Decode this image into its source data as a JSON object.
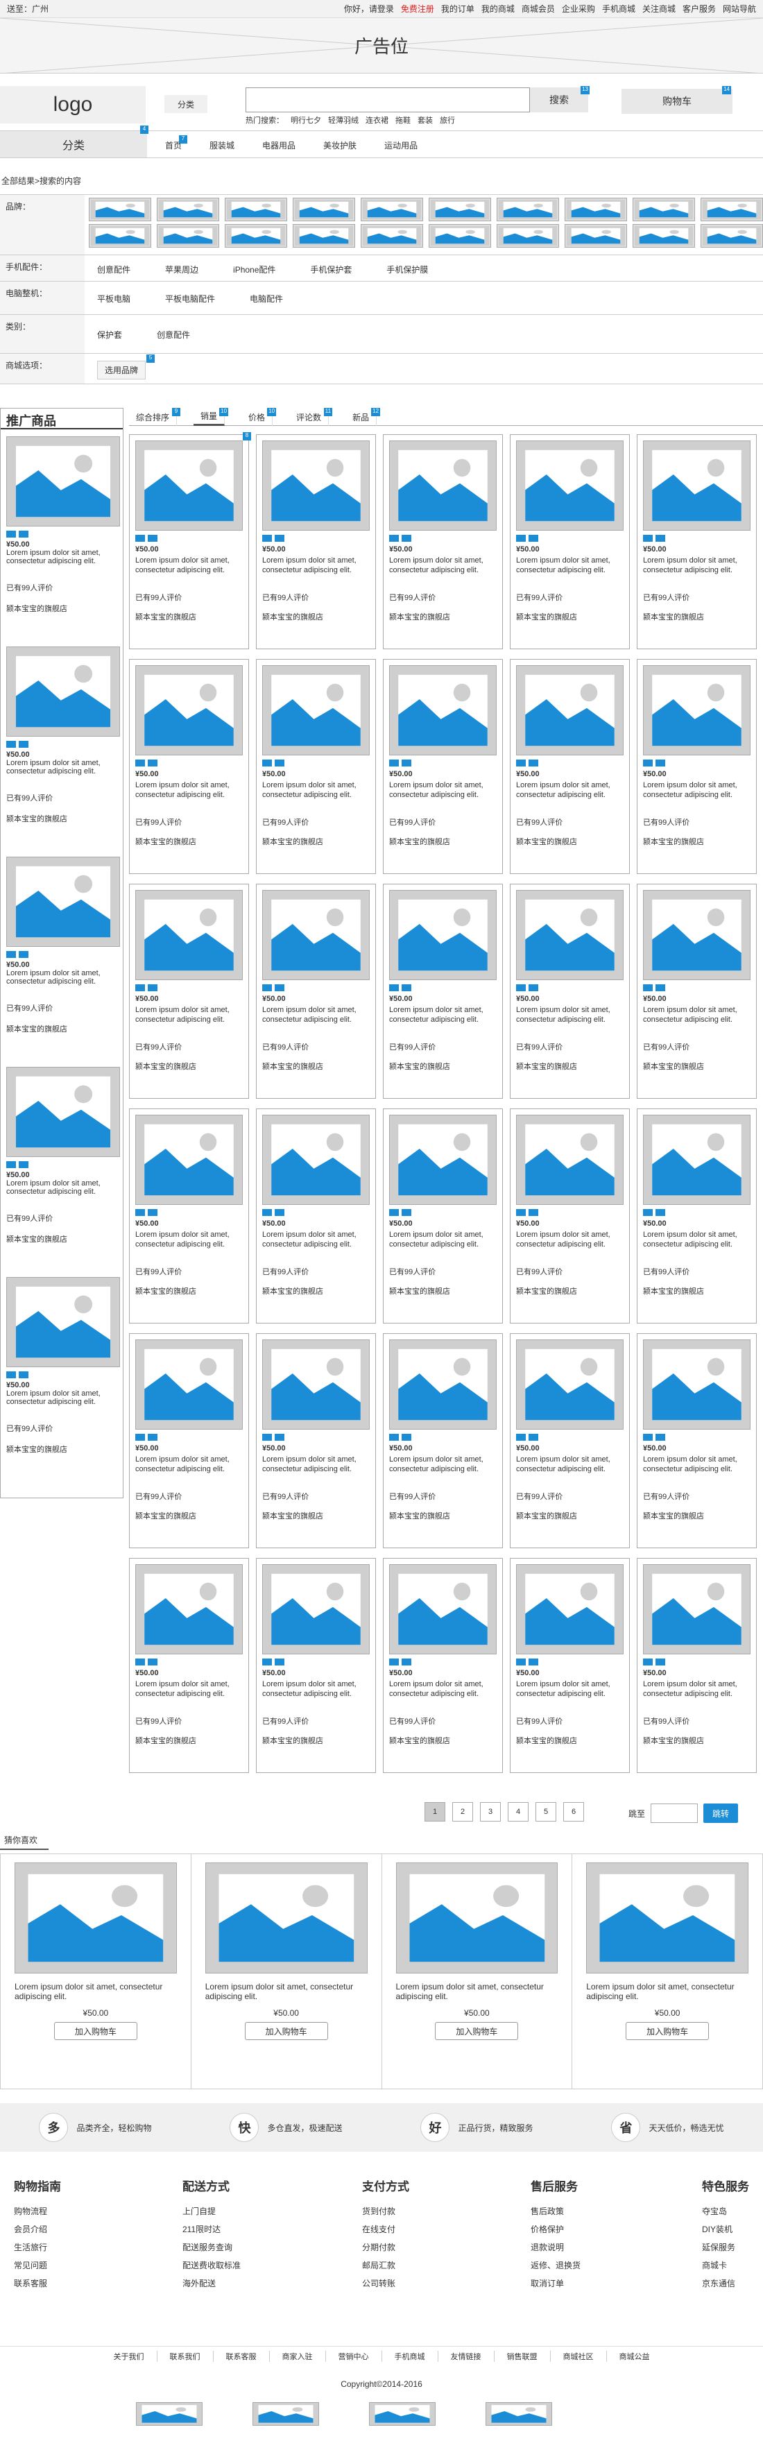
{
  "topbar": {
    "location": "送至：广州",
    "greeting": "你好，请登录",
    "register": "免费注册",
    "links": [
      "我的订单",
      "我的商城",
      "商城会员",
      "企业采购",
      "手机商城",
      "关注商城",
      "客户服务",
      "网站导航"
    ]
  },
  "ad": {
    "label": "广告位"
  },
  "header": {
    "logo": "logo",
    "category_button": "分类",
    "search_button": "搜索",
    "hot_label": "热门搜索：",
    "hot_terms": [
      "明行七夕",
      "轻薄羽绒",
      "连衣裙",
      "拖鞋",
      "套装",
      "旅行"
    ],
    "cart_button": "购物车",
    "badges": [
      "13",
      "14"
    ]
  },
  "nav": {
    "category": "分类",
    "items": [
      "首页",
      "服装城",
      "电器用品",
      "美妆护肤",
      "运动用品"
    ],
    "badge": "4",
    "home_badge": "7"
  },
  "crumb": "全部结果>搜索的内容",
  "filters": [
    {
      "label": "品牌：",
      "options": []
    },
    {
      "label": "手机配件：",
      "options": [
        "创意配件",
        "苹果周边",
        "iPhone配件",
        "手机保护套",
        "手机保护膜"
      ]
    },
    {
      "label": "电脑整机：",
      "options": [
        "平板电脑",
        "平板电脑配件",
        "电脑配件"
      ]
    },
    {
      "label": "类别：",
      "options": [
        "保护套",
        "创意配件"
      ]
    },
    {
      "label": "商城选项：",
      "options": [
        "选用品牌"
      ]
    }
  ],
  "brand_count": 20,
  "promo": {
    "title": "推广商品",
    "item": {
      "price": "¥50.00",
      "desc": "Lorem ipsum dolor sit amet, consectetur adipiscing elit.",
      "reviews": "已有99人评价",
      "shop": "颍本宝宝的旗舰店"
    }
  },
  "tabs": [
    {
      "label": "综合排序",
      "badge": "9"
    },
    {
      "label": "销量",
      "badge": "10"
    },
    {
      "label": "价格",
      "badge": "10"
    },
    {
      "label": "评论数",
      "badge": "11"
    },
    {
      "label": "新品",
      "badge": "12"
    }
  ],
  "product": {
    "price": "¥50.00",
    "desc": "Lorem ipsum dolor sit amet, consectetur adipiscing elit.",
    "reviews": "已有99人评价",
    "shop": "颍本宝宝的旗舰店",
    "first_badge": "8"
  },
  "pager": {
    "pages": [
      "1",
      "2",
      "3",
      "4",
      "5",
      "6"
    ],
    "goto_label": "跳至",
    "jump": "跳转"
  },
  "guess": {
    "title": "猜你喜欢",
    "items": [
      {
        "desc": "Lorem ipsum dolor sit amet, consectetur adipiscing elit.",
        "price": "¥50.00",
        "btn": "加入购物车"
      },
      {
        "desc": "Lorem ipsum dolor sit amet, consectetur adipiscing elit.",
        "price": "¥50.00",
        "btn": "加入购物车"
      },
      {
        "desc": "Lorem ipsum dolor sit amet, consectetur adipiscing elit.",
        "price": "¥50.00",
        "btn": "加入购物车"
      },
      {
        "desc": "Lorem ipsum dolor sit amet, consectetur adipiscing elit.",
        "price": "¥50.00",
        "btn": "加入购物车"
      }
    ]
  },
  "service": [
    {
      "icon": "多",
      "text": "品类齐全，轻松购物"
    },
    {
      "icon": "快",
      "text": "多仓直发，极速配送"
    },
    {
      "icon": "好",
      "text": "正品行货，精致服务"
    },
    {
      "icon": "省",
      "text": "天天低价，畅选无忧"
    }
  ],
  "footer": {
    "cols": [
      {
        "title": "购物指南",
        "links": [
          "购物流程",
          "会员介绍",
          "生活旅行",
          "常见问题",
          "联系客服"
        ]
      },
      {
        "title": "配送方式",
        "links": [
          "上门自提",
          "211限时达",
          "配送服务查询",
          "配送费收取标准",
          "海外配送"
        ]
      },
      {
        "title": "支付方式",
        "links": [
          "货到付款",
          "在线支付",
          "分期付款",
          "邮局汇款",
          "公司转账"
        ]
      },
      {
        "title": "售后服务",
        "links": [
          "售后政策",
          "价格保护",
          "退款说明",
          "返修、退换货",
          "取消订单"
        ]
      },
      {
        "title": "特色服务",
        "links": [
          "夺宝岛",
          "DIY装机",
          "延保服务",
          "商城卡",
          "京东通信"
        ]
      }
    ],
    "links": [
      "关于我们",
      "联系我们",
      "联系客服",
      "商家入驻",
      "营销中心",
      "手机商城",
      "友情链接",
      "销售联盟",
      "商城社区",
      "商城公益"
    ],
    "copyright": "Copyright©2014-2016"
  },
  "colors": {
    "accent": "#1b8dd6",
    "register": "#e02020"
  }
}
